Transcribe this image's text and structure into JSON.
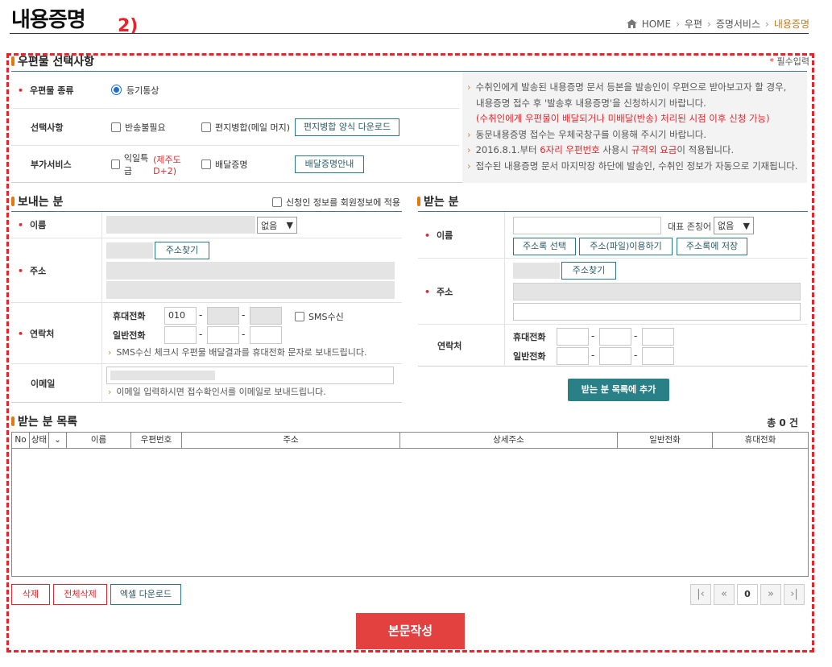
{
  "header": {
    "title": "내용증명",
    "annotation": "2)",
    "breadcrumb": [
      "HOME",
      "우편",
      "증명서비스",
      "내용증명"
    ]
  },
  "options": {
    "section_title": "우편물 선택사항",
    "required_note": "필수입력",
    "mail_type_label": "우편물 종류",
    "mail_type_value": "등기통상",
    "select_label": "선택사항",
    "opt_return": "반송불필요",
    "opt_merge": "편지병합(메일 머지)",
    "merge_download_button": "편지병합 양식 다운로드",
    "addon_label": "부가서비스",
    "opt_nextday": "익일특급",
    "opt_nextday_note": "(제주도 D+2)",
    "opt_delivery_cert": "배달증명",
    "delivery_guide_button": "배달증명안내",
    "info": [
      "수취인에게 발송된 내용증명 문서 등본을 발송인이 우편으로 받아보고자 할 경우,",
      "내용증명 접수 후 '발송후 내용증명'을 신청하시기 바랍니다.",
      "(수취인에게 우편물이 배달되거나 미배달(반송) 처리된 시점 이후 신청 가능)",
      "동문내용증명 접수는 우체국창구를 이용해 주시기 바랍니다.",
      "2016.8.1.부터",
      "6자리 우편번호",
      "사용시",
      "규격외 요금",
      "이 적용됩니다.",
      "접수된 내용증명 문서 마지막장 하단에 발송인, 수취인 정보가 자동으로 기재됩니다."
    ]
  },
  "sender": {
    "section_title": "보내는 분",
    "apply_member": "신청인 정보를 회원정보에 적용",
    "name_label": "이름",
    "honorific": "없음",
    "address_label": "주소",
    "find_address": "주소찾기",
    "contact_label": "연락처",
    "mobile_label": "휴대전화",
    "mobile_prefix": "010",
    "sms_label": "SMS수신",
    "phone_label": "일반전화",
    "sms_note": "SMS수신 체크시 우편물 배달결과를 휴대전화 문자로 보내드립니다.",
    "email_label": "이메일",
    "email_note": "이메일 입력하시면 접수확인서를 이메일로 보내드립니다."
  },
  "receiver": {
    "section_title": "받는 분",
    "name_label": "이름",
    "honorific_label": "대표 존칭어",
    "honorific": "없음",
    "addrbook_select": "주소록 선택",
    "file_use": "주소(파일)이용하기",
    "save_addrbook": "주소록에 저장",
    "address_label": "주소",
    "find_address": "주소찾기",
    "contact_label": "연락처",
    "mobile_label": "휴대전화",
    "phone_label": "일반전화",
    "add_button": "받는 분 목록에 추가"
  },
  "list": {
    "section_title": "받는 분 목록",
    "total": "총 0 건",
    "columns": [
      "No",
      "상태",
      "",
      "이름",
      "우편번호",
      "주소",
      "상세주소",
      "일반전화",
      "휴대전화"
    ],
    "delete": "삭제",
    "delete_all": "전체삭제",
    "excel": "엑셀 다운로드",
    "page": "0"
  },
  "submit": "본문작성",
  "colors": {
    "accent": "#e8242a",
    "teal": "#2a7a86",
    "bullet": "#e07a10"
  }
}
